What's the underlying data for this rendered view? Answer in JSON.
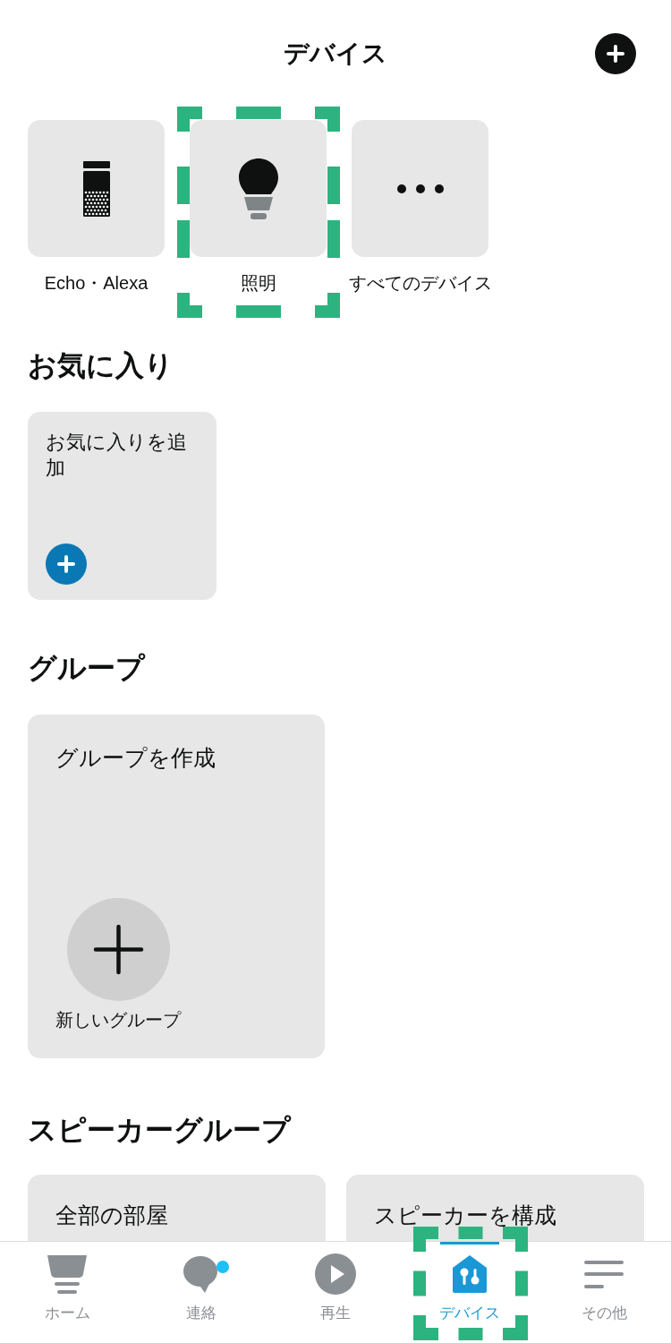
{
  "header": {
    "title": "デバイス"
  },
  "categories": [
    {
      "label": "Echo・Alexa",
      "kind": "speaker",
      "highlighted": false
    },
    {
      "label": "照明",
      "kind": "bulb",
      "highlighted": true
    },
    {
      "label": "すべてのデバイス",
      "kind": "more",
      "highlighted": false
    }
  ],
  "favorites": {
    "title": "お気に入り",
    "card": {
      "label": "お気に入りを追加"
    }
  },
  "groups": {
    "title": "グループ",
    "card": {
      "title": "グループを作成",
      "action": "新しいグループ"
    }
  },
  "speaker_groups": {
    "title": "スピーカーグループ",
    "cards": [
      {
        "title": "全部の部屋"
      },
      {
        "title": "スピーカーを構成"
      }
    ]
  },
  "bottom_nav": [
    {
      "label": "ホーム",
      "kind": "home",
      "selected": false,
      "badge": false,
      "highlighted": false
    },
    {
      "label": "連絡",
      "kind": "chat",
      "selected": false,
      "badge": true,
      "highlighted": false
    },
    {
      "label": "再生",
      "kind": "play",
      "selected": false,
      "badge": false,
      "highlighted": false
    },
    {
      "label": "デバイス",
      "kind": "devices",
      "selected": true,
      "badge": false,
      "highlighted": true
    },
    {
      "label": "その他",
      "kind": "more",
      "selected": false,
      "badge": false,
      "highlighted": false
    }
  ]
}
